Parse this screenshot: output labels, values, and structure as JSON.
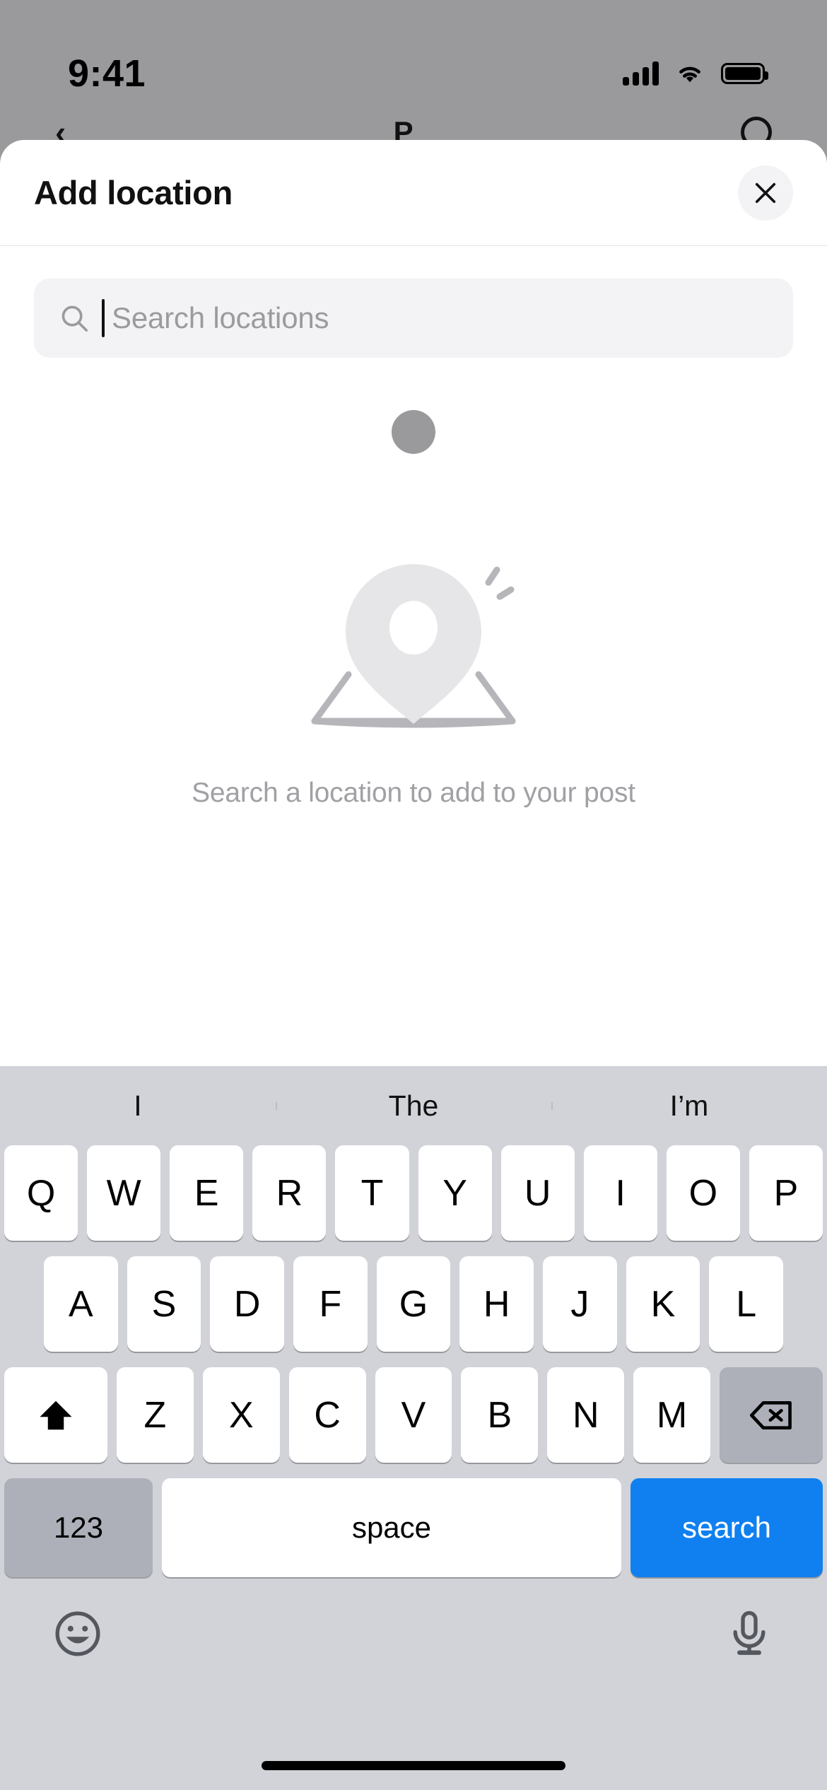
{
  "status_bar": {
    "time": "9:41",
    "signal_icon": "cellular-signal-icon",
    "wifi_icon": "wifi-icon",
    "battery_icon": "battery-full-icon"
  },
  "background": {
    "back_chevron": "‹",
    "title": "P",
    "right_icon": "circle-icon"
  },
  "sheet": {
    "title": "Add location",
    "close_icon": "close-icon"
  },
  "search": {
    "icon": "search-icon",
    "placeholder": "Search locations",
    "value": ""
  },
  "empty_state": {
    "illustration": "map-pin-illustration",
    "message": "Search a location to add to your post"
  },
  "keyboard": {
    "predictions": [
      "I",
      "The",
      "I’m"
    ],
    "row1": [
      "Q",
      "W",
      "E",
      "R",
      "T",
      "Y",
      "U",
      "I",
      "O",
      "P"
    ],
    "row2": [
      "A",
      "S",
      "D",
      "F",
      "G",
      "H",
      "J",
      "K",
      "L"
    ],
    "row3": [
      "Z",
      "X",
      "C",
      "V",
      "B",
      "N",
      "M"
    ],
    "shift_icon": "shift-icon",
    "backspace_icon": "backspace-icon",
    "numeric_label": "123",
    "space_label": "space",
    "return_label": "search",
    "emoji_icon": "emoji-icon",
    "dictation_icon": "microphone-icon"
  },
  "colors": {
    "accent_blue": "#1080f0",
    "keyboard_bg": "#d1d3d9",
    "key_bg": "#ffffff",
    "key_grey": "#adb0b9",
    "dim_backdrop": "#9a9a9d",
    "field_bg": "#f3f3f5",
    "placeholder_text": "#9b9b9f",
    "illustration_fill": "#e6e6e8",
    "illustration_stroke": "#b6b6ba"
  }
}
